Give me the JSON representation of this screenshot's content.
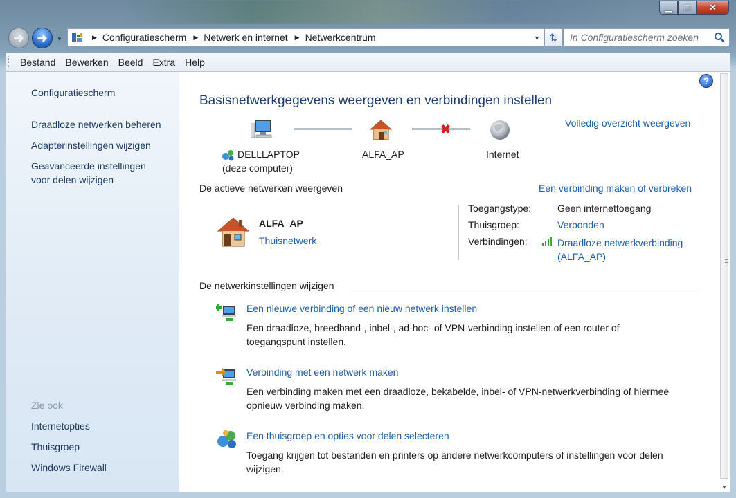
{
  "window": {
    "minimize_symbol": "▁",
    "maximize_symbol": "□",
    "close_symbol": "✕"
  },
  "nav": {
    "breadcrumbs": [
      "Configuratiescherm",
      "Netwerk en internet",
      "Netwerkcentrum"
    ],
    "search_placeholder": "In Configuratiescherm zoeken"
  },
  "menu": {
    "items": [
      "Bestand",
      "Bewerken",
      "Beeld",
      "Extra",
      "Help"
    ]
  },
  "sidebar": {
    "home": "Configuratiescherm",
    "links": [
      "Draadloze netwerken beheren",
      "Adapterinstellingen wijzigen",
      "Geavanceerde instellingen",
      "voor delen wijzigen"
    ],
    "see_also_heading": "Zie ook",
    "see_also": [
      "Internetopties",
      "Thuisgroep",
      "Windows Firewall"
    ]
  },
  "main": {
    "title": "Basisnetwerkgegevens weergeven en verbindingen instellen",
    "full_map_link": "Volledig overzicht weergeven",
    "map": {
      "computer_name": "DELLLAPTOP",
      "computer_sub": "(deze computer)",
      "router_name": "ALFA_AP",
      "internet_label": "Internet"
    },
    "active": {
      "heading": "De actieve netwerken weergeven",
      "connect_link": "Een verbinding maken of verbreken",
      "network_name": "ALFA_AP",
      "network_type": "Thuisnetwerk",
      "access_label": "Toegangstype:",
      "access_value": "Geen internettoegang",
      "homegroup_label": "Thuisgroep:",
      "homegroup_value": "Verbonden",
      "connections_label": "Verbindingen:",
      "connection_line1": "Draadloze netwerkverbinding",
      "connection_line2": "(ALFA_AP)"
    },
    "change": {
      "heading": "De netwerkinstellingen wijzigen",
      "tasks": [
        {
          "title": "Een nieuwe verbinding of een nieuw netwerk instellen",
          "desc1": "Een draadloze, breedband-, inbel-, ad-hoc- of VPN-verbinding instellen of een router of",
          "desc2": "toegangspunt instellen."
        },
        {
          "title": "Verbinding met een netwerk maken",
          "desc1": "Een verbinding maken met een draadloze, bekabelde, inbel- of VPN-netwerkverbinding of hiermee",
          "desc2": "opnieuw verbinding maken."
        },
        {
          "title": "Een thuisgroep en opties voor delen selecteren",
          "desc1": "Toegang krijgen tot bestanden en printers op andere netwerkcomputers of instellingen voor delen",
          "desc2": "wijzigen."
        }
      ]
    }
  },
  "colors": {
    "link": "#1d5fa8",
    "title": "#1e3a6e",
    "sidebar_text": "#1e3a5f",
    "error_x": "#d42020"
  }
}
